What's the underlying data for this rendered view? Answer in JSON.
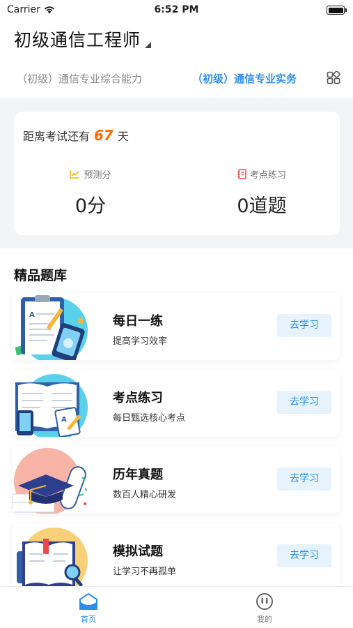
{
  "status_bar": {
    "carrier": "Carrier",
    "time": "6:52 PM"
  },
  "header": {
    "title": "初级通信工程师"
  },
  "subject_tabs": [
    {
      "label": "（初级）通信专业综合能力",
      "active": false
    },
    {
      "label": "（初级）通信专业实务",
      "active": true
    }
  ],
  "icons": {
    "grid": "grid-apps-icon",
    "predict": "trend-chart-icon",
    "practice": "notebook-icon",
    "home": "home-icon",
    "mine": "smile-face-icon"
  },
  "exam": {
    "prefix": "距离考试还有",
    "days": "67",
    "suffix": "天"
  },
  "stats": [
    {
      "label": "预测分",
      "value": "0分"
    },
    {
      "label": "考点练习",
      "value": "0道题"
    }
  ],
  "section_title": "精品题库",
  "courses": [
    {
      "name": "每日一练",
      "desc": "提高学习效率",
      "button": "去学习"
    },
    {
      "name": "考点练习",
      "desc": "每日甄选核心考点",
      "button": "去学习"
    },
    {
      "name": "历年真题",
      "desc": "数百人精心研发",
      "button": "去学习"
    },
    {
      "name": "模拟试题",
      "desc": "让学习不再孤单",
      "button": "去学习"
    }
  ],
  "tabbar": [
    {
      "label": "首页",
      "active": true
    },
    {
      "label": "我的",
      "active": false
    }
  ],
  "colors": {
    "accent": "#2b8ee8",
    "countdown": "#ff6a00",
    "button_bg": "#e6f3fc"
  }
}
